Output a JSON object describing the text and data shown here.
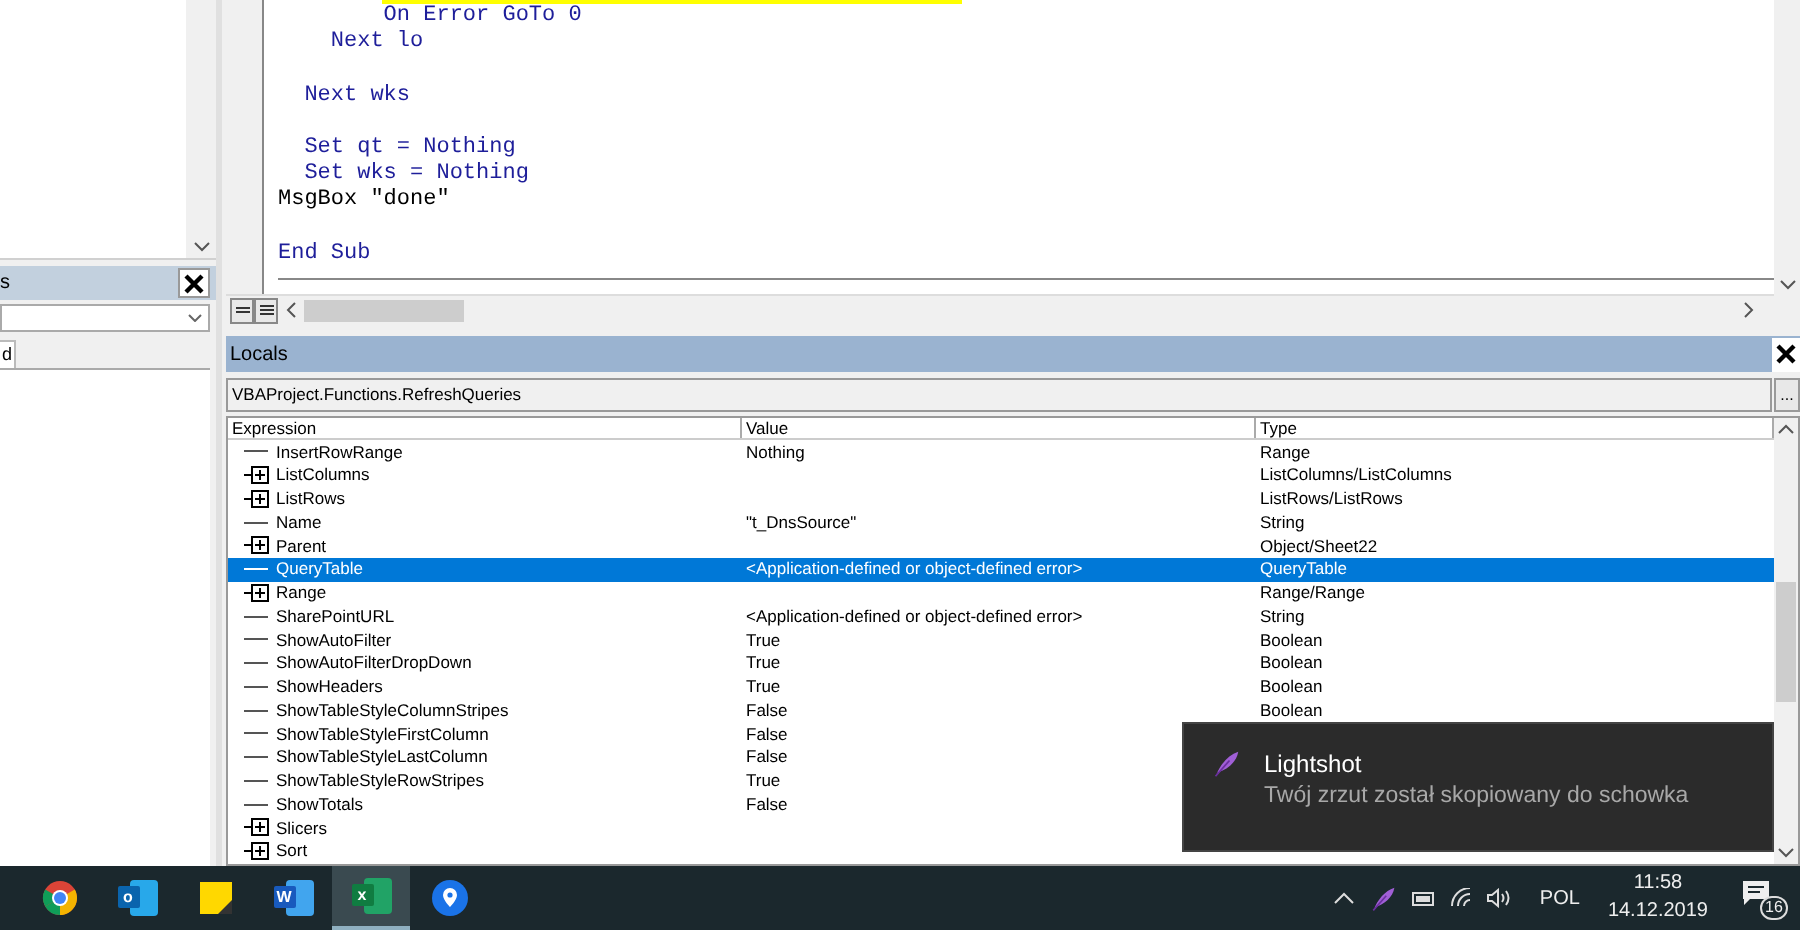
{
  "left_panel": {
    "properties_title": "s",
    "tab": "d"
  },
  "editor": {
    "lines": [
      {
        "kind": "keyword",
        "text": "        On Error GoTo 0"
      },
      {
        "kind": "keyword",
        "text": "    Next lo"
      },
      {
        "kind": "blank"
      },
      {
        "kind": "keyword",
        "text": "  Next wks"
      },
      {
        "kind": "blank"
      },
      {
        "kind": "keyword",
        "text": "  Set qt = Nothing"
      },
      {
        "kind": "keyword",
        "text": "  Set wks = Nothing"
      },
      {
        "kind": "plain",
        "text": "MsgBox \"done\""
      },
      {
        "kind": "blank"
      },
      {
        "kind": "keyword",
        "text": "End Sub"
      }
    ]
  },
  "locals": {
    "title": "Locals",
    "context": "VBAProject.Functions.RefreshQueries",
    "context_button": "...",
    "columns": [
      "Expression",
      "Value",
      "Type"
    ],
    "rows": [
      {
        "expression": "InsertRowRange",
        "value": "Nothing",
        "type": "Range",
        "expandable": false,
        "selected": false
      },
      {
        "expression": "ListColumns",
        "type": "ListColumns/ListColumns",
        "expandable": true,
        "selected": false
      },
      {
        "expression": "ListRows",
        "type": "ListRows/ListRows",
        "expandable": true,
        "selected": false
      },
      {
        "expression": "Name",
        "value": "\"t_DnsSource\"",
        "type": "String",
        "expandable": false,
        "selected": false
      },
      {
        "expression": "Parent",
        "type": "Object/Sheet22",
        "expandable": true,
        "selected": false
      },
      {
        "expression": "QueryTable",
        "value": "<Application-defined or object-defined error>",
        "type": "QueryTable",
        "expandable": false,
        "selected": true
      },
      {
        "expression": "Range",
        "type": "Range/Range",
        "expandable": true,
        "selected": false
      },
      {
        "expression": "SharePointURL",
        "value": "<Application-defined or object-defined error>",
        "type": "String",
        "expandable": false,
        "selected": false
      },
      {
        "expression": "ShowAutoFilter",
        "value": "True",
        "type": "Boolean",
        "expandable": false,
        "selected": false
      },
      {
        "expression": "ShowAutoFilterDropDown",
        "value": "True",
        "type": "Boolean",
        "expandable": false,
        "selected": false
      },
      {
        "expression": "ShowHeaders",
        "value": "True",
        "type": "Boolean",
        "expandable": false,
        "selected": false
      },
      {
        "expression": "ShowTableStyleColumnStripes",
        "value": "False",
        "type": "Boolean",
        "expandable": false,
        "selected": false
      },
      {
        "expression": "ShowTableStyleFirstColumn",
        "value": "False",
        "expandable": false,
        "selected": false
      },
      {
        "expression": "ShowTableStyleLastColumn",
        "value": "False",
        "expandable": false,
        "selected": false
      },
      {
        "expression": "ShowTableStyleRowStripes",
        "value": "True",
        "expandable": false,
        "selected": false
      },
      {
        "expression": "ShowTotals",
        "value": "False",
        "expandable": false,
        "selected": false
      },
      {
        "expression": "Slicers",
        "expandable": true,
        "selected": false
      },
      {
        "expression": "Sort",
        "expandable": true,
        "selected": false
      }
    ]
  },
  "toast": {
    "title": "Lightshot",
    "message": "Twój zrzut został skopiowany do schowka"
  },
  "taskbar": {
    "apps": [
      {
        "kind": "chrome",
        "active": false
      },
      {
        "kind": "outlook",
        "glyph": "o",
        "active": false
      },
      {
        "kind": "notes",
        "active": false
      },
      {
        "kind": "word",
        "glyph": "W",
        "active": false
      },
      {
        "kind": "excel",
        "glyph": "x",
        "active": true
      },
      {
        "kind": "maps",
        "active": false
      }
    ],
    "tray": {
      "language": "POL",
      "time": "11:58",
      "date": "14.12.2019",
      "notifications": "16"
    }
  }
}
